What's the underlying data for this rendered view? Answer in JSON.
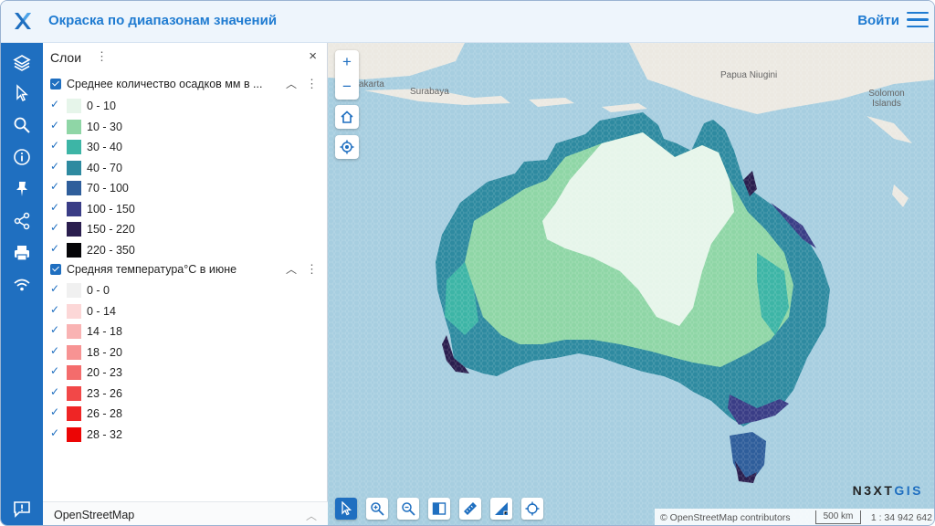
{
  "header": {
    "title": "Окраска по диапазонам значений",
    "login_label": "Войти"
  },
  "toolbar": {
    "tools": [
      "layers-icon",
      "select-icon",
      "search-icon",
      "info-icon",
      "pin-icon",
      "share-icon",
      "print-icon",
      "wifi-icon"
    ],
    "bottom": "feedback-icon"
  },
  "panel": {
    "title": "Слои",
    "close": "×",
    "layers": [
      {
        "name": "Среднее количество осадков мм в ...",
        "legend": [
          {
            "label": "0 - 10",
            "color": "#e6f5ea"
          },
          {
            "label": "10 - 30",
            "color": "#8fd6a6"
          },
          {
            "label": "30 - 40",
            "color": "#3db5a6"
          },
          {
            "label": "40 - 70",
            "color": "#2e8aa0"
          },
          {
            "label": "70 - 100",
            "color": "#2f5e9b"
          },
          {
            "label": "100 - 150",
            "color": "#3a3d86"
          },
          {
            "label": "150 - 220",
            "color": "#2a1e4e"
          },
          {
            "label": "220 - 350",
            "color": "#050508"
          }
        ]
      },
      {
        "name": "Средняя температура°С в июне",
        "legend": [
          {
            "label": "0 - 0",
            "color": "#f0f0f0"
          },
          {
            "label": "0 - 14",
            "color": "#fcd7d7"
          },
          {
            "label": "14 - 18",
            "color": "#f9b3b3"
          },
          {
            "label": "18 - 20",
            "color": "#f79393"
          },
          {
            "label": "20 - 23",
            "color": "#f46c6c"
          },
          {
            "label": "23 - 26",
            "color": "#f24848"
          },
          {
            "label": "26 - 28",
            "color": "#ef2525"
          },
          {
            "label": "28 - 32",
            "color": "#ec0505"
          }
        ]
      }
    ],
    "basemap": "OpenStreetMap"
  },
  "map": {
    "places": [
      "Papua Niugini",
      "Solomon Islands",
      "Surabaya",
      "akarta"
    ],
    "zoom_in": "+",
    "zoom_out": "−",
    "attribution": "© OpenStreetMap contributors",
    "scale": "500 km",
    "ratio": "1 : 34 942 642",
    "brand_left": "N3XT",
    "brand_right": "GIS"
  }
}
